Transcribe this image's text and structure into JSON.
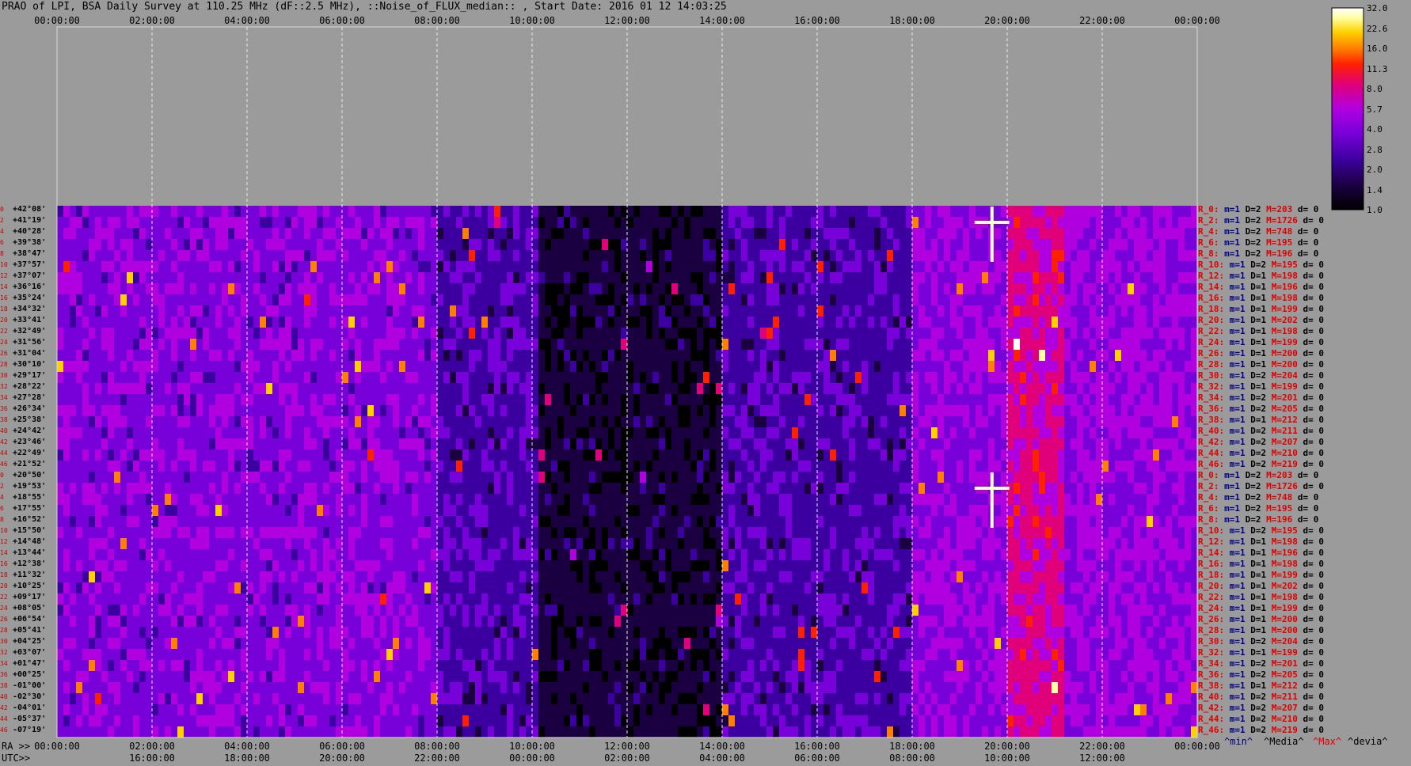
{
  "title": "PRAO of LPI, BSA Daily Survey at 110.25 MHz (dF::2.5 MHz), ::Noise_of_FLUX_median:: , Start Date: 2016 01 12 14:03:25",
  "chart_data": {
    "type": "heatmap",
    "title": "PRAO of LPI, BSA Daily Survey at 110.25 MHz (dF::2.5 MHz), ::Noise_of_FLUX_median:: , Start Date: 2016 01 12 14:03:25",
    "x_top_ticks": [
      "00:00:00",
      "02:00:00",
      "04:00:00",
      "06:00:00",
      "08:00:00",
      "10:00:00",
      "12:00:00",
      "14:00:00",
      "16:00:00",
      "18:00:00",
      "20:00:00",
      "22:00:00",
      "00:00:00"
    ],
    "x_ra_ticks": [
      "00:00:00",
      "02:00:00",
      "04:00:00",
      "06:00:00",
      "08:00:00",
      "10:00:00",
      "12:00:00",
      "14:00:00",
      "16:00:00",
      "18:00:00",
      "20:00:00",
      "22:00:00",
      "00:00:00"
    ],
    "x_utc_ticks": [
      "16:00:00",
      "18:00:00",
      "20:00:00",
      "22:00:00",
      "00:00:00",
      "02:00:00",
      "04:00:00",
      "06:00:00",
      "08:00:00",
      "10:00:00",
      "12:00:00"
    ],
    "ra_label": "RA >>",
    "utc_label": "UTC>>",
    "row_index_labels": [
      "0",
      "2",
      "4",
      "6",
      "8",
      "10",
      "12",
      "14",
      "16",
      "18",
      "20",
      "22",
      "24",
      "26",
      "28",
      "30",
      "32",
      "34",
      "36",
      "38",
      "40",
      "42",
      "44",
      "46",
      "0",
      "2",
      "4",
      "6",
      "8",
      "10",
      "12",
      "14",
      "16",
      "18",
      "20",
      "22",
      "24",
      "26",
      "28",
      "30",
      "32",
      "34",
      "36",
      "38",
      "40",
      "42",
      "44",
      "46"
    ],
    "declinations": [
      "+42°08'",
      "+41°19'",
      "+40°28'",
      "+39°38'",
      "+38°47'",
      "+37°57'",
      "+37°07'",
      "+36°16'",
      "+35°24'",
      "+34°32'",
      "+33°41'",
      "+32°49'",
      "+31°56'",
      "+31°04'",
      "+30°10'",
      "+29°17'",
      "+28°22'",
      "+27°28'",
      "+26°34'",
      "+25°38'",
      "+24°42'",
      "+23°46'",
      "+22°49'",
      "+21°52'",
      "+20°50'",
      "+19°53'",
      "+18°55'",
      "+17°55'",
      "+16°52'",
      "+15°50'",
      "+14°48'",
      "+13°44'",
      "+12°38'",
      "+11°32'",
      "+10°25'",
      "+09°17'",
      "+08°05'",
      "+06°54'",
      "+05°41'",
      "+04°25'",
      "+03°07'",
      "+01°47'",
      "+00°25'",
      "-01°00'",
      "-02°30'",
      "-04°01'",
      "-05°37'",
      "-07°19'"
    ],
    "row_stats": [
      {
        "r": "R_0:",
        "n": "m=1",
        "d": "D=2",
        "h": "M=203",
        "dv": "d= 0"
      },
      {
        "r": "R_2:",
        "n": "m=1",
        "d": "D=2",
        "h": "M=1726",
        "dv": "d= 0"
      },
      {
        "r": "R_4:",
        "n": "m=1",
        "d": "D=2",
        "h": "M=748",
        "dv": "d= 0"
      },
      {
        "r": "R_6:",
        "n": "m=1",
        "d": "D=2",
        "h": "M=195",
        "dv": "d= 0"
      },
      {
        "r": "R_8:",
        "n": "m=1",
        "d": "D=2",
        "h": "M=196",
        "dv": "d= 0"
      },
      {
        "r": "R_10:",
        "n": "m=1",
        "d": "D=2",
        "h": "M=195",
        "dv": "d= 0"
      },
      {
        "r": "R_12:",
        "n": "m=1",
        "d": "D=1",
        "h": "M=198",
        "dv": "d= 0"
      },
      {
        "r": "R_14:",
        "n": "m=1",
        "d": "D=1",
        "h": "M=196",
        "dv": "d= 0"
      },
      {
        "r": "R_16:",
        "n": "m=1",
        "d": "D=1",
        "h": "M=198",
        "dv": "d= 0"
      },
      {
        "r": "R_18:",
        "n": "m=1",
        "d": "D=1",
        "h": "M=199",
        "dv": "d= 0"
      },
      {
        "r": "R_20:",
        "n": "m=1",
        "d": "D=1",
        "h": "M=202",
        "dv": "d= 0"
      },
      {
        "r": "R_22:",
        "n": "m=1",
        "d": "D=1",
        "h": "M=198",
        "dv": "d= 0"
      },
      {
        "r": "R_24:",
        "n": "m=1",
        "d": "D=1",
        "h": "M=199",
        "dv": "d= 0"
      },
      {
        "r": "R_26:",
        "n": "m=1",
        "d": "D=1",
        "h": "M=200",
        "dv": "d= 0"
      },
      {
        "r": "R_28:",
        "n": "m=1",
        "d": "D=1",
        "h": "M=200",
        "dv": "d= 0"
      },
      {
        "r": "R_30:",
        "n": "m=1",
        "d": "D=2",
        "h": "M=204",
        "dv": "d= 0"
      },
      {
        "r": "R_32:",
        "n": "m=1",
        "d": "D=1",
        "h": "M=199",
        "dv": "d= 0"
      },
      {
        "r": "R_34:",
        "n": "m=1",
        "d": "D=2",
        "h": "M=201",
        "dv": "d= 0"
      },
      {
        "r": "R_36:",
        "n": "m=1",
        "d": "D=2",
        "h": "M=205",
        "dv": "d= 0"
      },
      {
        "r": "R_38:",
        "n": "m=1",
        "d": "D=1",
        "h": "M=212",
        "dv": "d= 0"
      },
      {
        "r": "R_40:",
        "n": "m=1",
        "d": "D=2",
        "h": "M=211",
        "dv": "d= 0"
      },
      {
        "r": "R_42:",
        "n": "m=1",
        "d": "D=2",
        "h": "M=207",
        "dv": "d= 0"
      },
      {
        "r": "R_44:",
        "n": "m=1",
        "d": "D=2",
        "h": "M=210",
        "dv": "d= 0"
      },
      {
        "r": "R_46:",
        "n": "m=1",
        "d": "D=2",
        "h": "M=219",
        "dv": "d= 0"
      },
      {
        "r": "R_0:",
        "n": "m=1",
        "d": "D=2",
        "h": "M=203",
        "dv": "d= 0"
      },
      {
        "r": "R_2:",
        "n": "m=1",
        "d": "D=2",
        "h": "M=1726",
        "dv": "d= 0"
      },
      {
        "r": "R_4:",
        "n": "m=1",
        "d": "D=2",
        "h": "M=748",
        "dv": "d= 0"
      },
      {
        "r": "R_6:",
        "n": "m=1",
        "d": "D=2",
        "h": "M=195",
        "dv": "d= 0"
      },
      {
        "r": "R_8:",
        "n": "m=1",
        "d": "D=2",
        "h": "M=196",
        "dv": "d= 0"
      },
      {
        "r": "R_10:",
        "n": "m=1",
        "d": "D=2",
        "h": "M=195",
        "dv": "d= 0"
      },
      {
        "r": "R_12:",
        "n": "m=1",
        "d": "D=1",
        "h": "M=198",
        "dv": "d= 0"
      },
      {
        "r": "R_14:",
        "n": "m=1",
        "d": "D=1",
        "h": "M=196",
        "dv": "d= 0"
      },
      {
        "r": "R_16:",
        "n": "m=1",
        "d": "D=1",
        "h": "M=198",
        "dv": "d= 0"
      },
      {
        "r": "R_18:",
        "n": "m=1",
        "d": "D=1",
        "h": "M=199",
        "dv": "d= 0"
      },
      {
        "r": "R_20:",
        "n": "m=1",
        "d": "D=1",
        "h": "M=202",
        "dv": "d= 0"
      },
      {
        "r": "R_22:",
        "n": "m=1",
        "d": "D=1",
        "h": "M=198",
        "dv": "d= 0"
      },
      {
        "r": "R_24:",
        "n": "m=1",
        "d": "D=1",
        "h": "M=199",
        "dv": "d= 0"
      },
      {
        "r": "R_26:",
        "n": "m=1",
        "d": "D=1",
        "h": "M=200",
        "dv": "d= 0"
      },
      {
        "r": "R_28:",
        "n": "m=1",
        "d": "D=1",
        "h": "M=200",
        "dv": "d= 0"
      },
      {
        "r": "R_30:",
        "n": "m=1",
        "d": "D=2",
        "h": "M=204",
        "dv": "d= 0"
      },
      {
        "r": "R_32:",
        "n": "m=1",
        "d": "D=1",
        "h": "M=199",
        "dv": "d= 0"
      },
      {
        "r": "R_34:",
        "n": "m=1",
        "d": "D=2",
        "h": "M=201",
        "dv": "d= 0"
      },
      {
        "r": "R_36:",
        "n": "m=1",
        "d": "D=2",
        "h": "M=205",
        "dv": "d= 0"
      },
      {
        "r": "R_38:",
        "n": "m=1",
        "d": "D=1",
        "h": "M=212",
        "dv": "d= 0"
      },
      {
        "r": "R_40:",
        "n": "m=1",
        "d": "D=2",
        "h": "M=211",
        "dv": "d= 0"
      },
      {
        "r": "R_42:",
        "n": "m=1",
        "d": "D=2",
        "h": "M=207",
        "dv": "d= 0"
      },
      {
        "r": "R_44:",
        "n": "m=1",
        "d": "D=2",
        "h": "M=210",
        "dv": "d= 0"
      },
      {
        "r": "R_46:",
        "n": "m=1",
        "d": "D=2",
        "h": "M=219",
        "dv": "d= 0"
      }
    ],
    "stats_legend": {
      "min": "^min^",
      "media": "^Media^",
      "max": "^Max^",
      "devia": "^devia^"
    },
    "colorbar_ticks": [
      "32.0",
      "22.6",
      "16.0",
      "11.3",
      "8.0",
      "5.7",
      "4.0",
      "2.8",
      "2.0",
      "1.4",
      "1.0"
    ],
    "colorscale": [
      "#000000",
      "#1a0040",
      "#3d00a0",
      "#7800d8",
      "#b000e0",
      "#e0007a",
      "#ff2000",
      "#ff8000",
      "#ffd000",
      "#ffffa0",
      "#ffffff"
    ],
    "background": "#9b9b9b"
  }
}
